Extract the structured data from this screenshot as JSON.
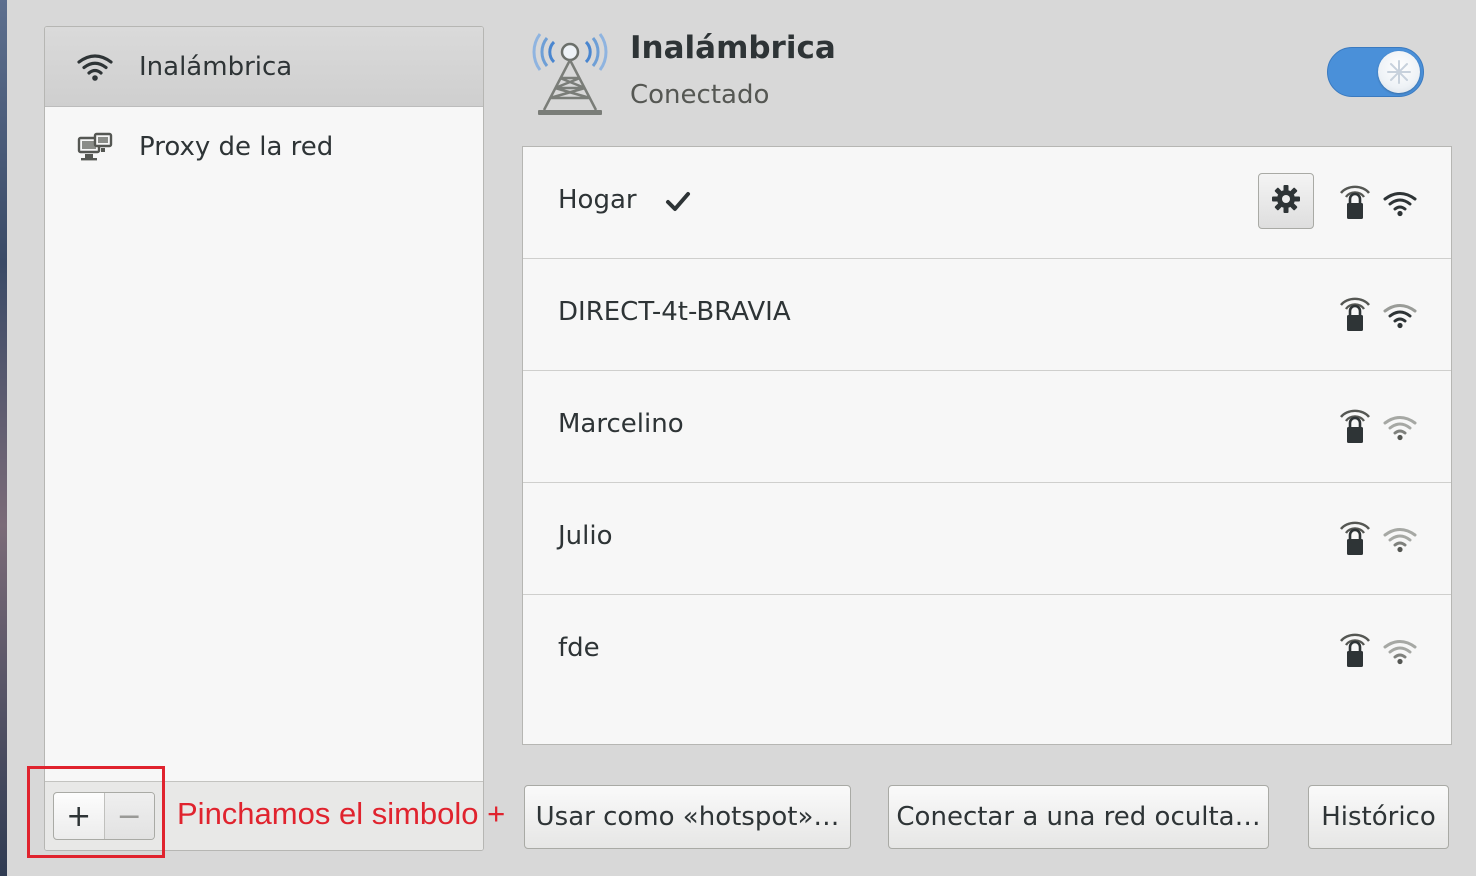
{
  "sidebar": {
    "items": [
      {
        "label": "Inalámbrica",
        "icon": "wifi-signal-icon",
        "selected": true
      },
      {
        "label": "Proxy de la red",
        "icon": "network-proxy-icon",
        "selected": false
      }
    ],
    "toolbar": {
      "add_label": "+",
      "remove_label": "−"
    }
  },
  "header": {
    "icon": "wireless-antenna-icon",
    "title": "Inalámbrica",
    "status": "Conectado",
    "toggle_on": true
  },
  "networks": [
    {
      "name": "Hogar",
      "connected": true,
      "secured": true,
      "signal": "strong"
    },
    {
      "name": "DIRECT-4t-BRAVIA",
      "connected": false,
      "secured": true,
      "signal": "strong"
    },
    {
      "name": "Marcelino",
      "connected": false,
      "secured": true,
      "signal": "weak"
    },
    {
      "name": "Julio",
      "connected": false,
      "secured": true,
      "signal": "weak"
    },
    {
      "name": "fde",
      "connected": false,
      "secured": true,
      "signal": "weak"
    }
  ],
  "buttons": {
    "hotspot": "Usar como «hotspot»…",
    "hidden": "Conectar a una red oculta…",
    "history": "Histórico"
  },
  "annotation": {
    "text": "Pinchamos el simbolo +",
    "color": "#e0232e"
  },
  "colors": {
    "accent": "#4a90d9",
    "annotation": "#e0232e"
  }
}
